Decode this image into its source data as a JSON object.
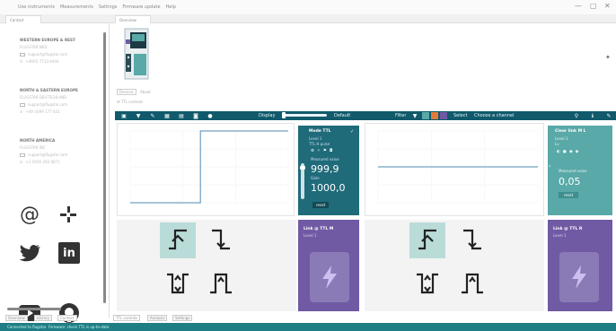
{
  "menubar": {
    "items": [
      "Use instruments",
      "Measurements",
      "Settings",
      "Firmware update",
      "Help"
    ]
  },
  "window": {
    "minimize": "—",
    "maximize": "▢",
    "close": "✕"
  },
  "left": {
    "tab_label": "Contact",
    "contacts": [
      {
        "region": "WESTERN EUROPE & REST",
        "company": "FLUGSTAR NED",
        "email": "support@flugstar.com",
        "phone": "+49(0) 7713-4444"
      },
      {
        "region": "NORTH & EASTERN EUROPE",
        "company": "FLUGSTAR DEUTSCHLAND",
        "email": "support@flugstar.com",
        "phone": "+49 (0)99 177 632"
      },
      {
        "region": "NORTH AMERICA",
        "company": "FLUGSTAR INC",
        "email": "support@flugstar.com",
        "phone": "+1 (919) 283 6671"
      }
    ],
    "bottom_tabs": [
      "Overview",
      "Library",
      "Contact"
    ]
  },
  "main": {
    "top_tab": "Overview",
    "sub_tabs": [
      "Devices",
      "About"
    ],
    "sub_label": "TTL controls",
    "bottom_tabs": [
      "TTL controls",
      "Analysis",
      "Settings"
    ]
  },
  "toolbar": {
    "display_label": "Display",
    "default_label": "Default",
    "filter_label": "Filter",
    "select_label": "Select",
    "channel_placeholder": "Choose a channel",
    "icons": [
      "save-icon",
      "filter-icon",
      "tool-icon",
      "grid-icon",
      "table-icon",
      "camera-icon",
      "record-icon"
    ]
  },
  "left_channel": {
    "panel_title": "Mode TTL",
    "panel_sub1": "Level 1",
    "panel_sub2": "TTL H pulse",
    "measure_label": "Measured value",
    "measure_value": "999,9",
    "gate_label": "Gate",
    "gate_value": "1000,0",
    "reset_label": "reset",
    "ttl_title": "Link @ TTL M",
    "ttl_sub": "Level 1",
    "chart_data": {
      "type": "line",
      "series": [
        {
          "values": [
            0,
            0,
            0,
            0,
            1,
            1,
            1,
            1,
            1,
            1
          ]
        }
      ]
    }
  },
  "right_channel": {
    "panel_title": "Clear link M L",
    "panel_sub1": "Level 1",
    "panel_sub2": "Lv",
    "measure_label": "Measured value",
    "measure_value": "0,05",
    "reset_label": "reset",
    "ttl_title": "Link @ TTL R",
    "ttl_sub": "Level 1",
    "chart_data": {
      "type": "line",
      "series": [
        {
          "values": [
            0.5,
            0.5,
            0.5,
            0.5,
            0.5,
            0.5,
            0.5,
            0.5
          ]
        }
      ]
    }
  },
  "statusbar": {
    "text": "Connected to flugstar. Firmware: check TTL is up-to-date"
  },
  "colors": {
    "teal_dark": "#105a6c",
    "teal_panel": "#1f6b7a",
    "teal_light": "#58a9a8",
    "purple": "#6f5aa3",
    "ttl_selected": "#b9dcd9",
    "status": "#1f7d86"
  }
}
